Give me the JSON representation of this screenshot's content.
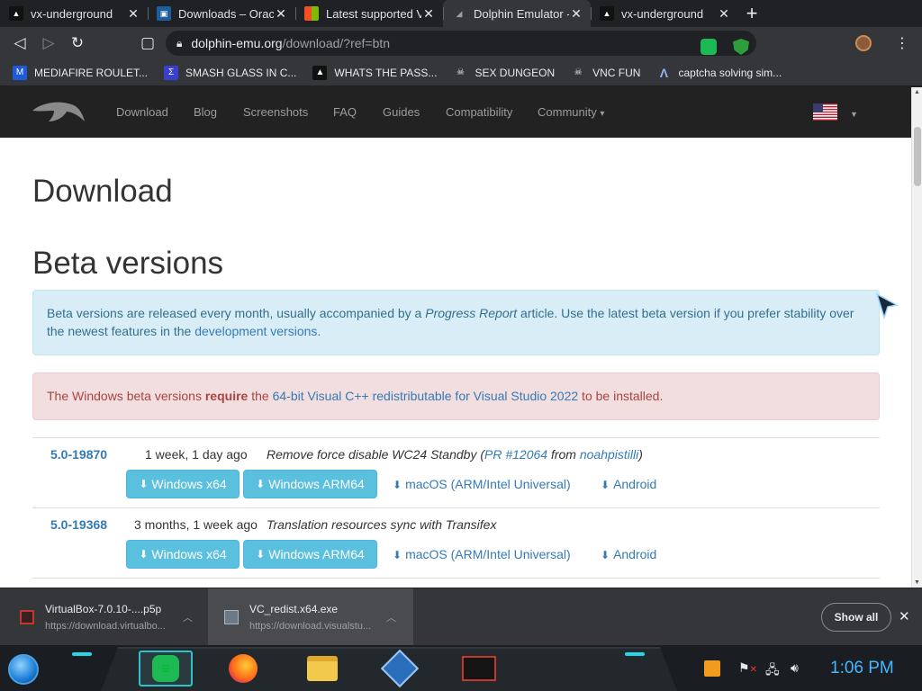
{
  "browser": {
    "tabs": [
      {
        "title": "vx-underground",
        "favicon": "vx-underground-favicon"
      },
      {
        "title": "Downloads – Oracle",
        "favicon": "virtualbox-favicon"
      },
      {
        "title": "Latest supported Vi",
        "favicon": "microsoft-favicon"
      },
      {
        "title": "Dolphin Emulator - ",
        "favicon": "dolphin-favicon",
        "active": true
      },
      {
        "title": "vx-underground",
        "favicon": "vx-underground-favicon"
      }
    ],
    "new_tab_label": "+",
    "url_host": "dolphin-emu.org",
    "url_path": "/download/?ref=btn",
    "bookmarks": [
      {
        "label": "MEDIAFIRE ROULET...",
        "icon": "mediafire-icon"
      },
      {
        "label": "SMASH GLASS IN C...",
        "icon": "smash-icon"
      },
      {
        "label": "WHATS THE PASS...",
        "icon": "vx-icon"
      },
      {
        "label": "SEX DUNGEON",
        "icon": "pirate-icon"
      },
      {
        "label": "VNC FUN",
        "icon": "pirate-icon"
      },
      {
        "label": "captcha solving sim...",
        "icon": "a-icon"
      }
    ]
  },
  "site": {
    "nav": [
      "Download",
      "Blog",
      "Screenshots",
      "FAQ",
      "Guides",
      "Compatibility",
      "Community"
    ],
    "community_caret": "▾",
    "page_title": "Download",
    "section_title": "Beta versions",
    "info_alert": {
      "text1": "Beta versions are released every month, usually accompanied by a ",
      "em": "Progress Report",
      "text2": " article. Use the latest beta version if you prefer stability over the newest features in the ",
      "link": "development versions",
      "text3": "."
    },
    "danger_alert": {
      "text1": "The Windows beta versions ",
      "strong": "require",
      "text2": " the ",
      "link": "64-bit Visual C++ redistributable for Visual Studio 2022",
      "text3": " to be installed."
    },
    "versions": [
      {
        "version": "5.0-19870",
        "age": "1 week, 1 day ago",
        "desc": "Remove force disable WC24 Standby",
        "desc_paren_open": " (",
        "pr": "PR #12064",
        "desc_from": " from ",
        "author": "noahpistilli",
        "desc_paren_close": ")",
        "buttons": [
          "Windows x64",
          "Windows ARM64"
        ],
        "links": [
          "macOS (ARM/Intel Universal)",
          "Android"
        ]
      },
      {
        "version": "5.0-19368",
        "age": "3 months, 1 week ago",
        "desc": "Translation resources sync with Transifex",
        "buttons": [
          "Windows x64",
          "Windows ARM64"
        ],
        "links": [
          "macOS (ARM/Intel Universal)",
          "Android"
        ]
      }
    ]
  },
  "downloads": {
    "items": [
      {
        "name": "VirtualBox-7.0.10-....p5p",
        "source": "https://download.virtualbo..."
      },
      {
        "name": "VC_redist.x64.exe",
        "source": "https://download.visualstu..."
      }
    ],
    "show_all": "Show all"
  },
  "taskbar": {
    "clock": "1:06 PM"
  },
  "colors": {
    "link": "#337ab7",
    "info_bg": "#d9edf7",
    "danger_bg": "#f2dede",
    "button": "#5bc0de",
    "nav_bg": "#222222"
  }
}
